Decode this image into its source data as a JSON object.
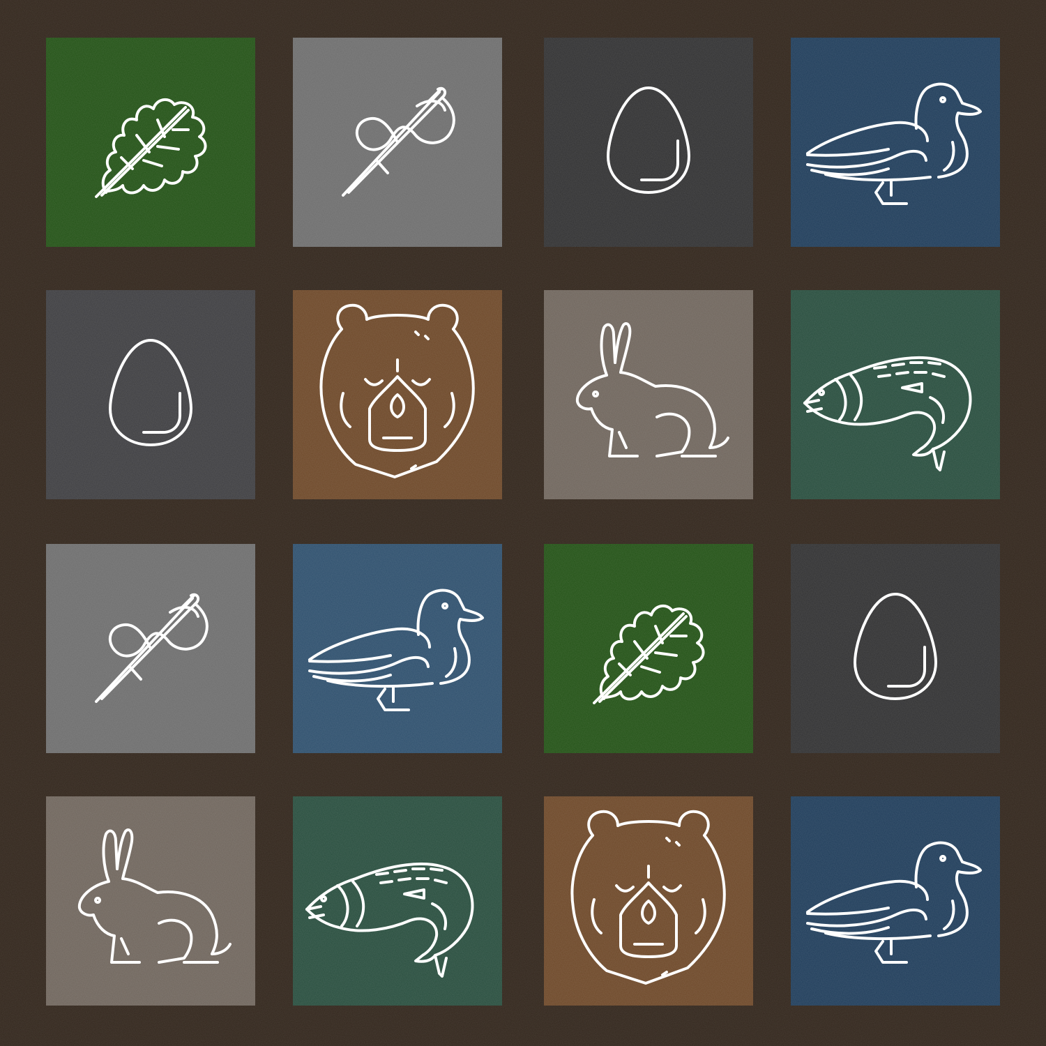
{
  "tiles": [
    {
      "icon": "oak-leaf-icon",
      "color": "#1f4f12"
    },
    {
      "icon": "needle-thread-icon",
      "color": "#6b6b6b"
    },
    {
      "icon": "egg-icon",
      "color": "#2e2e2f"
    },
    {
      "icon": "duck-icon",
      "color": "#1c3a58"
    },
    {
      "icon": "egg-icon",
      "color": "#3b3b3e"
    },
    {
      "icon": "bear-icon",
      "color": "#6b4525"
    },
    {
      "icon": "rabbit-icon",
      "color": "#6d635a"
    },
    {
      "icon": "fish-icon",
      "color": "#254b3b"
    },
    {
      "icon": "needle-thread-icon",
      "color": "#6b6b6b"
    },
    {
      "icon": "duck-icon",
      "color": "#2b4d6b"
    },
    {
      "icon": "oak-leaf-icon",
      "color": "#1f4f12"
    },
    {
      "icon": "egg-icon",
      "color": "#2e2e2f"
    },
    {
      "icon": "rabbit-icon",
      "color": "#6d635a"
    },
    {
      "icon": "fish-icon",
      "color": "#254b3b"
    },
    {
      "icon": "bear-icon",
      "color": "#6b4525"
    },
    {
      "icon": "duck-icon",
      "color": "#1c3a58"
    }
  ],
  "background_color": "#33271d",
  "icon_color": "#ffffff"
}
